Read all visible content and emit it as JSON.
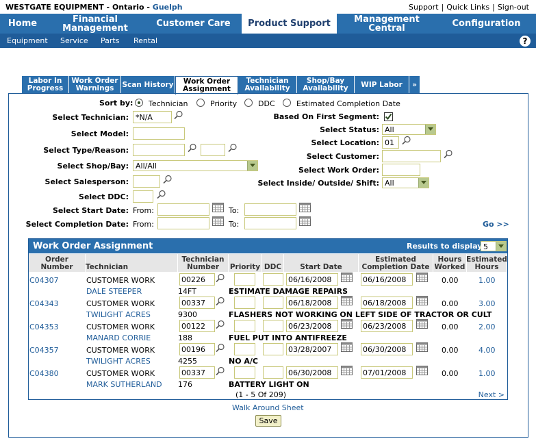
{
  "header": {
    "company": "WESTGATE EQUIPMENT - Ontario - ",
    "location": "Guelph",
    "links": [
      "Support",
      "Quick Links",
      "Sign-out"
    ]
  },
  "main_nav": [
    {
      "label": "Home",
      "active": false
    },
    {
      "label": "Financial Management",
      "active": false
    },
    {
      "label": "Customer Care",
      "active": false
    },
    {
      "label": "Product Support",
      "active": true
    },
    {
      "label": "Management Central",
      "active": false
    },
    {
      "label": "Configuration",
      "active": false
    }
  ],
  "sub_nav": [
    "Equipment",
    "Service",
    "Parts",
    "Rental"
  ],
  "help_glyph": "?",
  "tabs": [
    {
      "label": "Labor In Progress",
      "active": false
    },
    {
      "label": "Work Order Warnings",
      "active": false
    },
    {
      "label": "Scan History",
      "active": false
    },
    {
      "label": "Work Order Assignment",
      "active": true
    },
    {
      "label": "Technician Availability",
      "active": false
    },
    {
      "label": "Shop/Bay Availability",
      "active": false
    },
    {
      "label": "WIP Labor",
      "active": false
    },
    {
      "label": "»",
      "active": false
    }
  ],
  "filters": {
    "sort_by_label": "Sort by:",
    "sort_options": [
      {
        "label": "Technician",
        "selected": true
      },
      {
        "label": "Priority",
        "selected": false
      },
      {
        "label": "DDC",
        "selected": false
      },
      {
        "label": "Estimated Completion Date",
        "selected": false
      }
    ],
    "technician_label": "Select Technician:",
    "technician_value": "*N/A",
    "model_label": "Select Model:",
    "model_value": "",
    "type_reason_label": "Select Type/Reason:",
    "type_value": "",
    "reason_value": "",
    "shop_bay_label": "Select Shop/Bay:",
    "shop_bay_value": "All/All",
    "salesperson_label": "Select Salesperson:",
    "salesperson_value": "",
    "ddc_label": "Select DDC:",
    "ddc_value": "",
    "start_date_label": "Select Start Date:",
    "completion_date_label": "Select Completion Date:",
    "from_label": "From:",
    "to_label": "To:",
    "first_segment_label": "Based On First Segment:",
    "first_segment_checked": true,
    "status_label": "Select Status:",
    "status_value": "All",
    "location_label": "Select Location:",
    "location_value": "01",
    "customer_label": "Select Customer:",
    "customer_value": "",
    "work_order_label": "Select Work Order:",
    "work_order_value": "",
    "inside_outside_label": "Select Inside/ Outside/ Shift:",
    "inside_outside_value": "All",
    "go_label": "Go >>"
  },
  "results": {
    "title": "Work Order Assignment",
    "results_to_display_label": "Results to display:",
    "results_to_display_value": "5",
    "columns": [
      "Order Number",
      "Technician",
      "Technician Number",
      "Priority",
      "DDC",
      "Start Date",
      "Estimated Completion Date",
      "Hours Worked",
      "Estimated Hours"
    ],
    "rows": [
      {
        "order": "C04307",
        "work": "CUSTOMER WORK",
        "tech_number": "00226",
        "priority": "",
        "ddc": "",
        "start": "06/16/2008",
        "est_completion": "06/16/2008",
        "hours_worked": "0.00",
        "est_hours": "1.00",
        "customer": "DALE STEEPER",
        "unit": "14FT",
        "description": "ESTIMATE DAMAGE REPAIRS"
      },
      {
        "order": "C04343",
        "work": "CUSTOMER WORK",
        "tech_number": "00337",
        "priority": "",
        "ddc": "",
        "start": "06/18/2008",
        "est_completion": "06/18/2008",
        "hours_worked": "0.00",
        "est_hours": "3.00",
        "customer": "TWILIGHT ACRES",
        "unit": "9300",
        "description": "FLASHERS NOT WORKING ON LEFT SIDE OF TRACTOR OR CULT"
      },
      {
        "order": "C04353",
        "work": "CUSTOMER WORK",
        "tech_number": "00122",
        "priority": "",
        "ddc": "",
        "start": "06/23/2008",
        "est_completion": "06/23/2008",
        "hours_worked": "0.00",
        "est_hours": "2.00",
        "customer": "MANARD CORRIE",
        "unit": "188",
        "description": "FUEL PUT INTO ANTIFREEZE"
      },
      {
        "order": "C04357",
        "work": "CUSTOMER WORK",
        "tech_number": "00196",
        "priority": "",
        "ddc": "",
        "start": "03/28/2007",
        "est_completion": "06/30/2008",
        "hours_worked": "0.00",
        "est_hours": "4.00",
        "customer": "TWILIGHT ACRES",
        "unit": "4255",
        "description": "NO A/C"
      },
      {
        "order": "C04380",
        "work": "CUSTOMER WORK",
        "tech_number": "00337",
        "priority": "",
        "ddc": "",
        "start": "06/30/2008",
        "est_completion": "07/01/2008",
        "hours_worked": "0.00",
        "est_hours": "1.00",
        "customer": "MARK SUTHERLAND",
        "unit": "176",
        "description": "BATTERY LIGHT ON"
      }
    ],
    "pager": "(1 - 5 Of 209)",
    "next_label": "Next >"
  },
  "footer": {
    "walk_around_label": "Walk Around Sheet",
    "save_label": "Save"
  }
}
